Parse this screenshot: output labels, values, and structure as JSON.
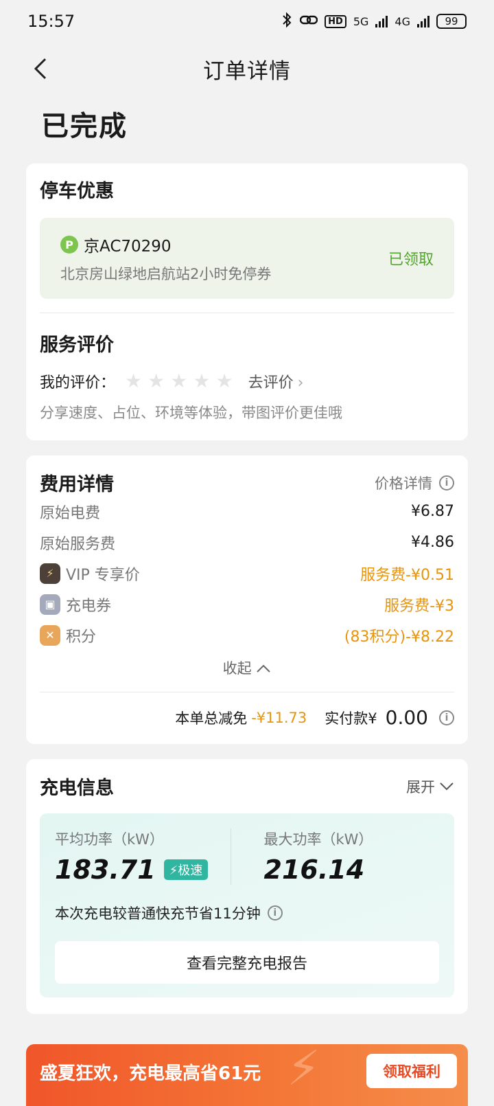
{
  "status_bar": {
    "time": "15:57",
    "hd": "HD",
    "net_5g": "5G",
    "net_4g": "4G",
    "battery": "99"
  },
  "nav": {
    "title": "订单详情"
  },
  "order_status": "已完成",
  "parking": {
    "title": "停车优惠",
    "plate": "京AC70290",
    "p_icon": "P",
    "desc": "北京房山绿地启航站2小时免停券",
    "coupon_status": "已领取"
  },
  "review": {
    "title": "服务评价",
    "my_label": "我的评价：",
    "action": "去评价",
    "hint": "分享速度、占位、环境等体验，带图评价更佳哦"
  },
  "fee": {
    "title": "费用详情",
    "price_detail": "价格详情",
    "rows": [
      {
        "label": "原始电费",
        "value": "¥6.87"
      },
      {
        "label": "原始服务费",
        "value": "¥4.86"
      },
      {
        "label": "VIP 专享价",
        "value": "服务费-¥0.51"
      },
      {
        "label": "充电券",
        "value": "服务费-¥3"
      },
      {
        "label": "积分",
        "value": "(83积分)-¥8.22"
      }
    ],
    "collapse": "收起",
    "total_label": "本单总减免",
    "total_value": "-¥11.73",
    "paid_label": "实付款¥",
    "paid_value": "0.00"
  },
  "charge": {
    "title": "充电信息",
    "expand": "展开",
    "avg_label": "平均功率（kW）",
    "avg_value": "183.71",
    "fast_badge": "极速",
    "max_label": "最大功率（kW）",
    "max_value": "216.14",
    "save_text": "本次充电较普通快充节省11分钟",
    "report_btn": "查看完整充电报告"
  },
  "promo": {
    "text": "盛夏狂欢，充电最高省61元",
    "button": "领取福利"
  },
  "colors": {
    "accent_green": "#52a62b",
    "accent_orange": "#e8940c",
    "teal": "#2fb5a0",
    "promo": "#f0562a"
  }
}
